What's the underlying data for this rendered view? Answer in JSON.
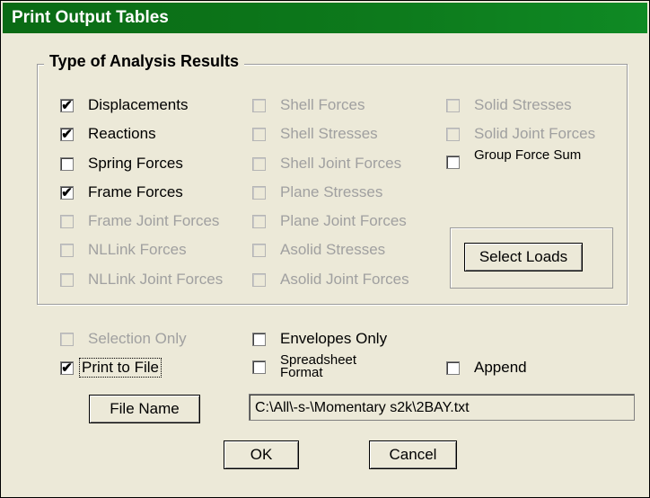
{
  "window": {
    "title": "Print Output Tables"
  },
  "group": {
    "title": "Type of Analysis Results",
    "col1": [
      {
        "label": "Displacements",
        "checked": true,
        "enabled": true
      },
      {
        "label": "Reactions",
        "checked": true,
        "enabled": true
      },
      {
        "label": "Spring Forces",
        "checked": false,
        "enabled": true
      },
      {
        "label": "Frame Forces",
        "checked": true,
        "enabled": true
      },
      {
        "label": "Frame Joint Forces",
        "checked": false,
        "enabled": false
      },
      {
        "label": "NLLink Forces",
        "checked": false,
        "enabled": false
      },
      {
        "label": "NLLink Joint Forces",
        "checked": false,
        "enabled": false
      }
    ],
    "col2": [
      {
        "label": "Shell Forces",
        "checked": false,
        "enabled": false
      },
      {
        "label": "Shell Stresses",
        "checked": false,
        "enabled": false
      },
      {
        "label": "Shell Joint Forces",
        "checked": false,
        "enabled": false
      },
      {
        "label": "Plane Stresses",
        "checked": false,
        "enabled": false
      },
      {
        "label": "Plane Joint Forces",
        "checked": false,
        "enabled": false
      },
      {
        "label": "Asolid Stresses",
        "checked": false,
        "enabled": false
      },
      {
        "label": "Asolid Joint Forces",
        "checked": false,
        "enabled": false
      }
    ],
    "col3": [
      {
        "label": "Solid Stresses",
        "checked": false,
        "enabled": false
      },
      {
        "label": "Solid Joint Forces",
        "checked": false,
        "enabled": false
      },
      {
        "label": "Group Force Sum",
        "checked": false,
        "enabled": true
      }
    ],
    "select_loads_label": "Select Loads"
  },
  "options": {
    "selection_only": {
      "label": "Selection Only",
      "checked": false,
      "enabled": false
    },
    "envelopes_only": {
      "label": "Envelopes Only",
      "checked": false,
      "enabled": true
    },
    "print_to_file": {
      "label": "Print to File",
      "checked": true,
      "enabled": true
    },
    "spreadsheet_format": {
      "label": "Spreadsheet Format",
      "checked": false,
      "enabled": true
    },
    "append": {
      "label": "Append",
      "checked": false,
      "enabled": true
    }
  },
  "file": {
    "button_label": "File Name",
    "path": "C:\\All\\-s-\\Momentary s2k\\2BAY.txt"
  },
  "buttons": {
    "ok": "OK",
    "cancel": "Cancel"
  },
  "check_glyph": "✔"
}
